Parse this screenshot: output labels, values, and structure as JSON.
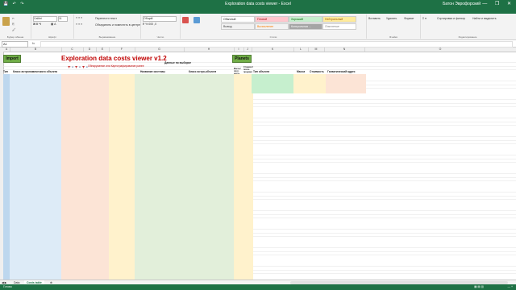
{
  "window": {
    "title": "Exploration data costs viewer - Excel",
    "user": "Батон Эврофорский",
    "controls": "—  ❐  ✕"
  },
  "ribbon_tabs": [
    "Файл",
    "Главная",
    "Вставка",
    "Разметка страницы",
    "Формулы",
    "Данные",
    "Рецензирование",
    "Вид",
    "Разработчик",
    "Power Pivot",
    "Что вы хотите сделать?"
  ],
  "ribbon": {
    "font_name": "Calibri",
    "font_size": "11",
    "wrap_text": "Перенести текст",
    "merge": "Объединить и поместить в центре",
    "number_format": "Общий",
    "styles": [
      "Обычный",
      "Плохой",
      "Хороший",
      "Нейтральный",
      "Вывод",
      "Вычисление",
      "Контрольная ...",
      "Пояснение"
    ],
    "groups": [
      "Буфер обмена",
      "Шрифт",
      "Выравнивание",
      "Число",
      "Стили",
      "Ячейки",
      "Редактирование"
    ],
    "cells_actions": [
      "Вставить",
      "Удалить",
      "Формат"
    ],
    "edit_actions": [
      "Сортировка и фильтр",
      "Найти и выделить"
    ]
  },
  "formula_bar": {
    "name_box": "A1",
    "fx": "fx"
  },
  "columns": [
    "A",
    "B",
    "C",
    "D",
    "E",
    "F",
    "G",
    "H",
    "I",
    "J",
    "K",
    "L",
    "M",
    "N",
    "O"
  ],
  "sheet": {
    "import_label": "Import",
    "planets_label": "Planets",
    "banner": "Exploration data costs viewer v1.2",
    "data_header": "Данные по выборке",
    "sub_header": "Обнаружение или Картографирование ранее",
    "col_headers": {
      "type": "Тип",
      "class": "Класс астрономического объекта",
      "name": "Название системы",
      "body_class": "Класс астро-объекта",
      "mass": "Масса/плот-ность",
      "cost": "Стоимость после продажи",
      "type2": "Тип объекта",
      "mass2": "Масса",
      "cost2": "Стоимость",
      "galactic": "Галактический адрес"
    }
  },
  "sheet_tabs": [
    "Data",
    "Costs table"
  ],
  "status": "Готово"
}
